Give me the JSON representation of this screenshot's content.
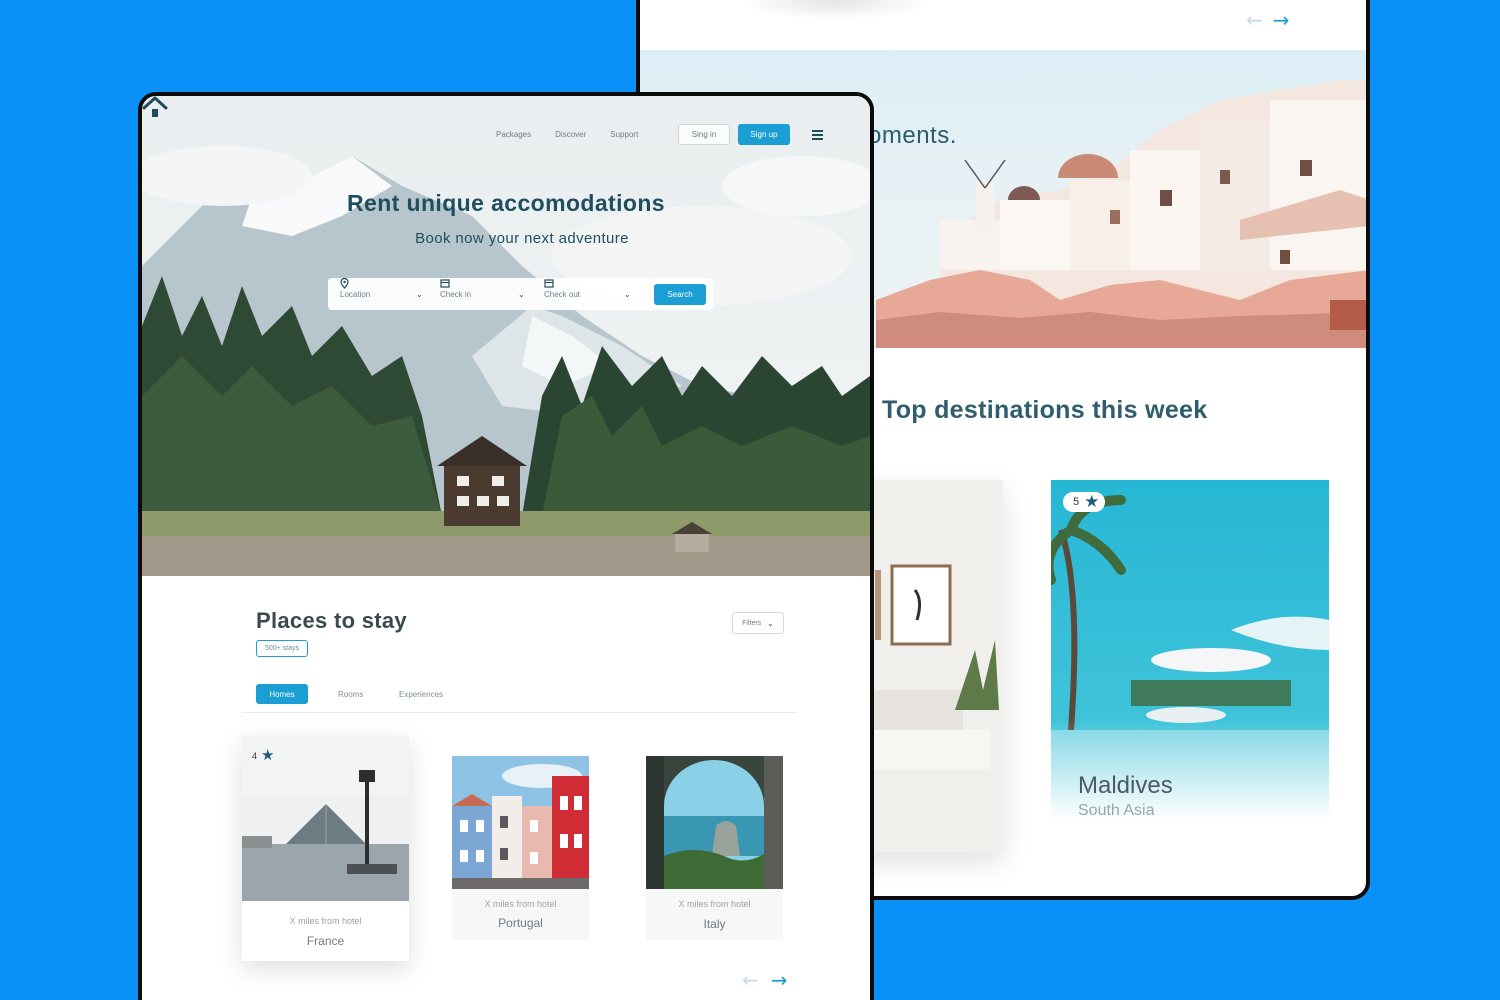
{
  "back": {
    "hero_text": "oments.",
    "section_title": "Top destinations this week",
    "featured_card": {
      "rating": "5",
      "name": "Maldives",
      "region": "South Asia"
    }
  },
  "front": {
    "nav": {
      "packages": "Packages",
      "discover": "Discover",
      "support": "Support"
    },
    "signin_label": "Sing in",
    "signup_label": "Sign up",
    "hero_title": "Rent unique accomodations",
    "hero_subtitle": "Book now your next adventure",
    "search": {
      "location": "Location",
      "checkin": "Check in",
      "checkout": "Check out",
      "button": "Search"
    },
    "places_title": "Places to stay",
    "stays_badge": "500+ stays",
    "filters_label": "Filters",
    "tabs": {
      "homes": "Homes",
      "rooms": "Rooms",
      "experiences": "Experiences"
    },
    "cards": [
      {
        "rating": "4",
        "distance": "X miles from hotel",
        "country": "France"
      },
      {
        "distance": "X miles from hotel",
        "country": "Portugal"
      },
      {
        "distance": "X miles from hotel",
        "country": "Italy"
      }
    ]
  },
  "icons": {
    "logo": "home-logo-icon",
    "location": "map-pin-icon",
    "calendar": "calendar-icon",
    "chevron": "chevron-down-icon",
    "menu": "hamburger-menu-icon",
    "star": "star-icon",
    "arrow_left": "arrow-left-icon",
    "arrow_right": "arrow-right-icon"
  },
  "colors": {
    "background": "#0a91f7",
    "accent": "#1a9ed4",
    "heading": "#1f4f5f"
  }
}
